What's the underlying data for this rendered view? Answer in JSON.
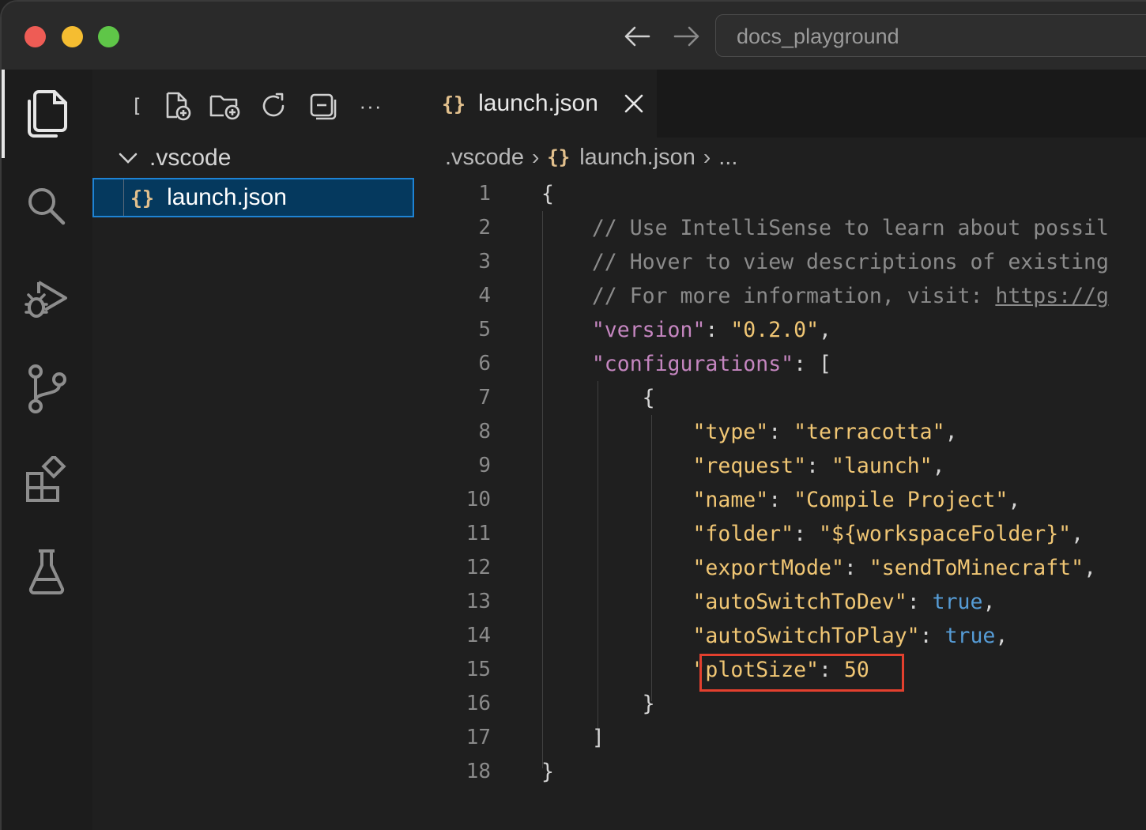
{
  "window": {
    "search_text": "docs_playground"
  },
  "activity_bar": {
    "items": [
      {
        "name": "explorer-icon",
        "active": true
      },
      {
        "name": "search-icon"
      },
      {
        "name": "run-debug-icon"
      },
      {
        "name": "source-control-icon"
      },
      {
        "name": "extensions-icon"
      },
      {
        "name": "testing-icon"
      }
    ]
  },
  "sidebar": {
    "toolbar": [
      "new-file-icon",
      "new-folder-icon",
      "refresh-icon",
      "collapse-all-icon",
      "more-actions-icon"
    ],
    "folder_label": ".vscode",
    "file_label": "launch.json",
    "file_icon_text": "{}"
  },
  "editor": {
    "tab": {
      "label": "launch.json",
      "icon_text": "{}"
    },
    "breadcrumb": {
      "folder": ".vscode",
      "icon_text": "{}",
      "file": "launch.json",
      "more": "..."
    },
    "lines": [
      {
        "n": "1"
      },
      {
        "n": "2"
      },
      {
        "n": "3"
      },
      {
        "n": "4"
      },
      {
        "n": "5"
      },
      {
        "n": "6"
      },
      {
        "n": "7"
      },
      {
        "n": "8"
      },
      {
        "n": "9"
      },
      {
        "n": "10"
      },
      {
        "n": "11"
      },
      {
        "n": "12"
      },
      {
        "n": "13"
      },
      {
        "n": "14"
      },
      {
        "n": "15"
      },
      {
        "n": "16"
      },
      {
        "n": "17"
      },
      {
        "n": "18"
      }
    ],
    "code": {
      "l1": "{",
      "l2": "// Use IntelliSense to learn about possil",
      "l3": "// Hover to view descriptions of existing",
      "l4_a": "// For more information, visit: ",
      "l4_b": "https://g",
      "l5_key": "\"version\"",
      "l5_val": "\"0.2.0\"",
      "l6_key": "\"configurations\"",
      "l6_rest": "[",
      "l7": "{",
      "l8_key": "\"type\"",
      "l8_val": "\"terracotta\"",
      "l9_key": "\"request\"",
      "l9_val": "\"launch\"",
      "l10_key": "\"name\"",
      "l10_val": "\"Compile Project\"",
      "l11_key": "\"folder\"",
      "l11_val": "\"${workspaceFolder}\"",
      "l12_key": "\"exportMode\"",
      "l12_val": "\"sendToMinecraft\"",
      "l13_key": "\"autoSwitchToDev\"",
      "l13_val": "true",
      "l14_key": "\"autoSwitchToPlay\"",
      "l14_val": "true",
      "l15_key": "\"plotSize\"",
      "l15_val": "50",
      "l16": "}",
      "l17": "]",
      "l18": "}"
    }
  },
  "colors": {
    "highlight": "#e3402e",
    "selection_bg": "#05395e",
    "selection_border": "#1e83d4"
  }
}
